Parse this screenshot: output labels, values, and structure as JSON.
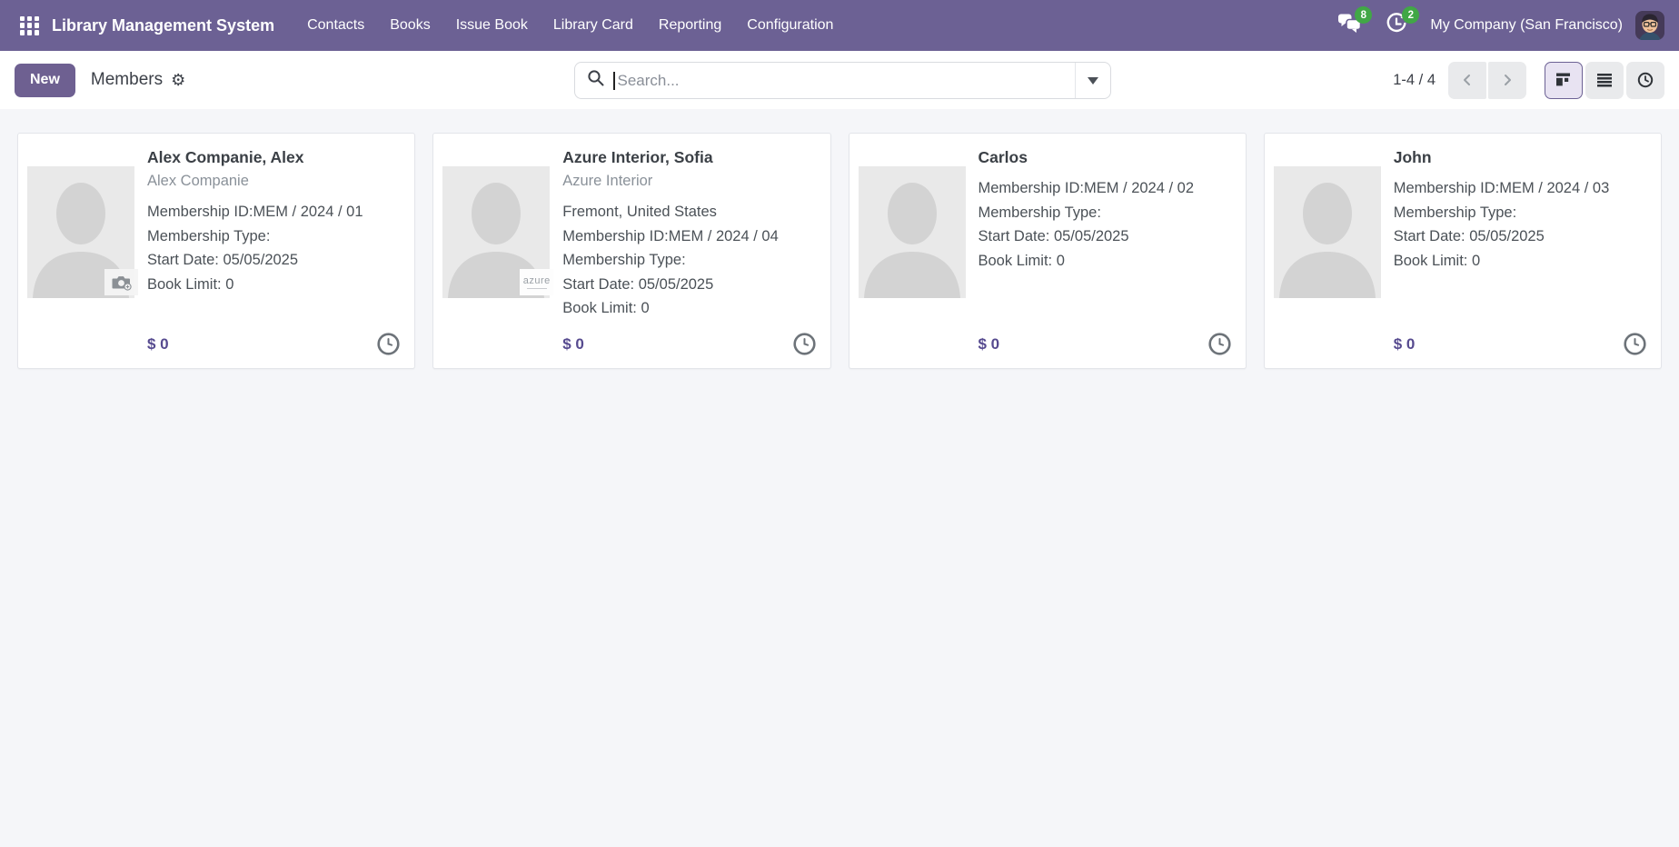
{
  "navbar": {
    "brand": "Library Management System",
    "menu": [
      "Contacts",
      "Books",
      "Issue Book",
      "Library Card",
      "Reporting",
      "Configuration"
    ],
    "messages_badge": "8",
    "activities_badge": "2",
    "company": "My Company (San Francisco)"
  },
  "control_panel": {
    "new_label": "New",
    "breadcrumb": "Members",
    "search": {
      "placeholder": "Search..."
    },
    "pager": {
      "range": "1-4 / 4"
    }
  },
  "cards": [
    {
      "title": "Alex Companie, Alex",
      "subtitle": "Alex Companie",
      "membership_id": "Membership ID:MEM / 2024 / 01",
      "membership_type": "Membership Type:",
      "start_date": "Start Date: 05/05/2025",
      "book_limit": "Book Limit: 0",
      "amount": "$ 0"
    },
    {
      "title": "Azure Interior, Sofia",
      "subtitle": "Azure Interior",
      "location": "Fremont, United States",
      "membership_id": "Membership ID:MEM / 2024 / 04",
      "membership_type": "Membership Type:",
      "start_date": "Start Date: 05/05/2025",
      "book_limit": "Book Limit: 0",
      "amount": "$ 0",
      "image_badge_text": "azure"
    },
    {
      "title": "Carlos",
      "membership_id": "Membership ID:MEM / 2024 / 02",
      "membership_type": "Membership Type:",
      "start_date": "Start Date: 05/05/2025",
      "book_limit": "Book Limit: 0",
      "amount": "$ 0"
    },
    {
      "title": "John",
      "membership_id": "Membership ID:MEM / 2024 / 03",
      "membership_type": "Membership Type:",
      "start_date": "Start Date: 05/05/2025",
      "book_limit": "Book Limit: 0",
      "amount": "$ 0"
    }
  ],
  "icons": {
    "apps": "grid-icon",
    "messages": "chat-bubbles-icon",
    "activities": "clock-arrow-icon",
    "settings": "gear-icon",
    "search": "magnifier-icon",
    "view_kanban": "kanban-icon",
    "view_list": "list-icon",
    "view_activity": "clock-icon"
  },
  "colors": {
    "navbar_bg": "#6c6194",
    "badge_green": "#41a746",
    "primary_button": "#6e6091",
    "amount_purple": "#564a8f",
    "page_bg": "#f5f6f9"
  }
}
